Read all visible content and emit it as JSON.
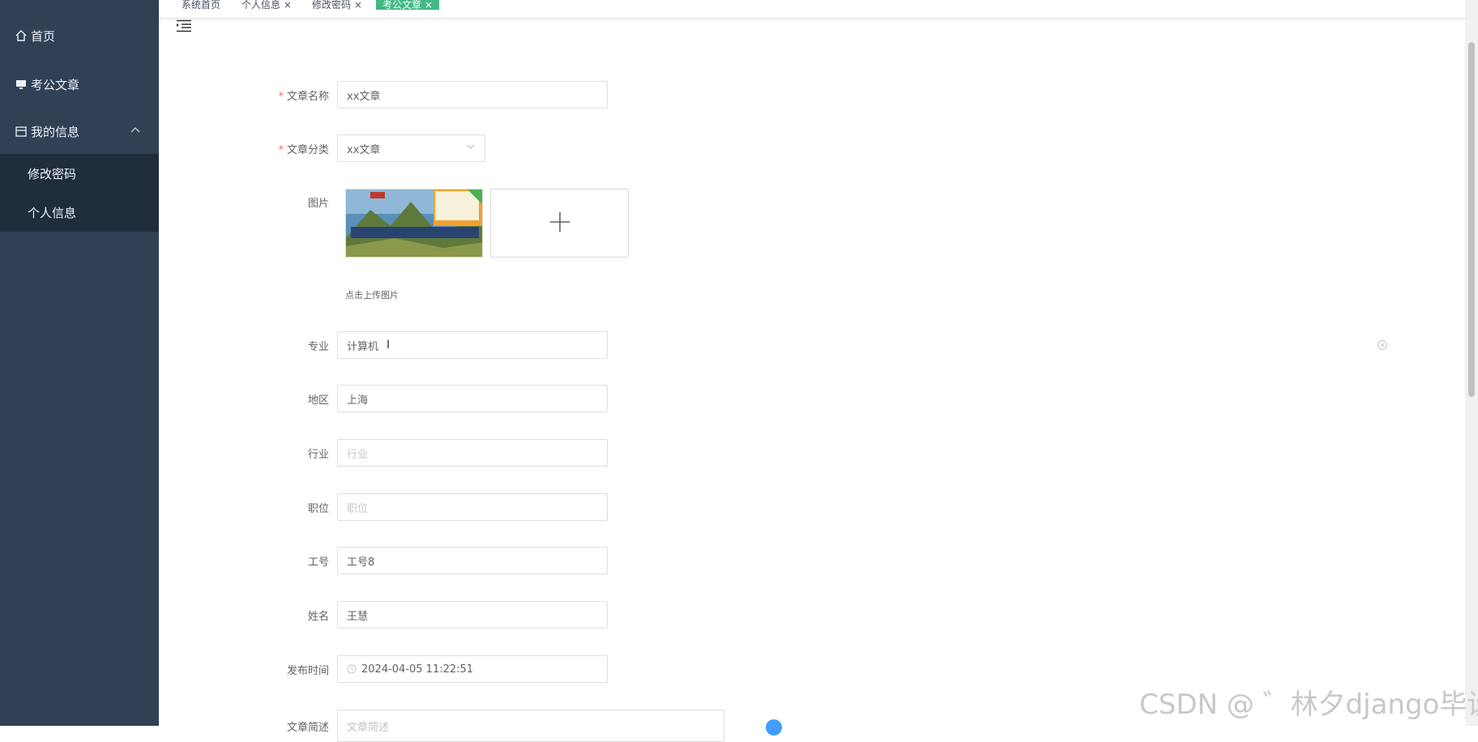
{
  "sidebar": {
    "items": [
      {
        "label": "首页",
        "icon": "home-icon"
      },
      {
        "label": "考公文章",
        "icon": "monitor-icon"
      },
      {
        "label": "我的信息",
        "icon": "calendar-icon"
      }
    ],
    "submenu": [
      {
        "label": "修改密码"
      },
      {
        "label": "个人信息"
      }
    ]
  },
  "tags": [
    {
      "label": "系统首页"
    },
    {
      "label": "个人信息 ×"
    },
    {
      "label": "修改密码 ×"
    },
    {
      "label": "考公文章 ×"
    }
  ],
  "form": {
    "title_label": "文章名称",
    "title_value": "xx文章",
    "category_label": "文章分类",
    "category_value": "xx文章",
    "image_label": "图片",
    "upload_tip": "点击上传图片",
    "major_label": "专业",
    "major_value": "计算机",
    "region_label": "地区",
    "region_value": "上海",
    "industry_label": "行业",
    "industry_placeholder": "行业",
    "position_label": "职位",
    "position_placeholder": "职位",
    "jobno_label": "工号",
    "jobno_value": "工号8",
    "name_label": "姓名",
    "name_value": "王慧",
    "pubtime_label": "发布时间",
    "pubtime_value": "2024-04-05 11:22:51",
    "summary_label": "文章简述",
    "summary_placeholder": "文章简述"
  },
  "watermark": "CSDN @ ゛林夕django毕设",
  "colors": {
    "sidebar_bg": "#304156",
    "submenu_bg": "#1f2d3d",
    "active_tag": "#42b983",
    "required_star": "#f56c6c"
  }
}
